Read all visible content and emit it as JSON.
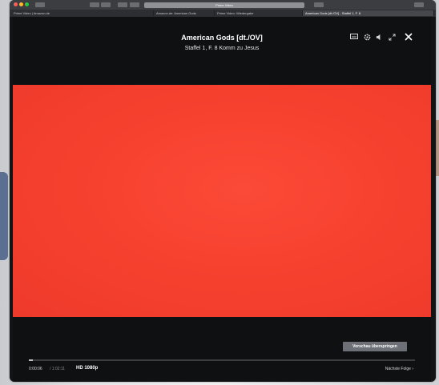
{
  "browser": {
    "url_text": "Prime Video",
    "tabs": [
      {
        "label": "Prime Video | Amazon.de"
      },
      {
        "label": "Amazon.de: American Gods"
      },
      {
        "label": "Prime Video: Wiedergabe"
      },
      {
        "label": "American Gods [dt./OV] - Staffel 1, F. 8"
      }
    ]
  },
  "player": {
    "title": "American Gods [dt./OV]",
    "subtitle": "Staffel 1, F. 8 Komm zu Jesus",
    "skip_button_label": "Vorschau überspringen",
    "time_current": "0:00:06",
    "time_total": "1:02:11",
    "quality_label": "HD 1080p",
    "next_episode_label": "Nächste Folge ›",
    "progress": 0.01,
    "video_color": "#f7412f"
  },
  "icons": {
    "subtitles": "subtitles-icon",
    "settings": "gear-icon",
    "volume": "volume-icon",
    "fullscreen": "fullscreen-icon",
    "close": "close-icon"
  }
}
